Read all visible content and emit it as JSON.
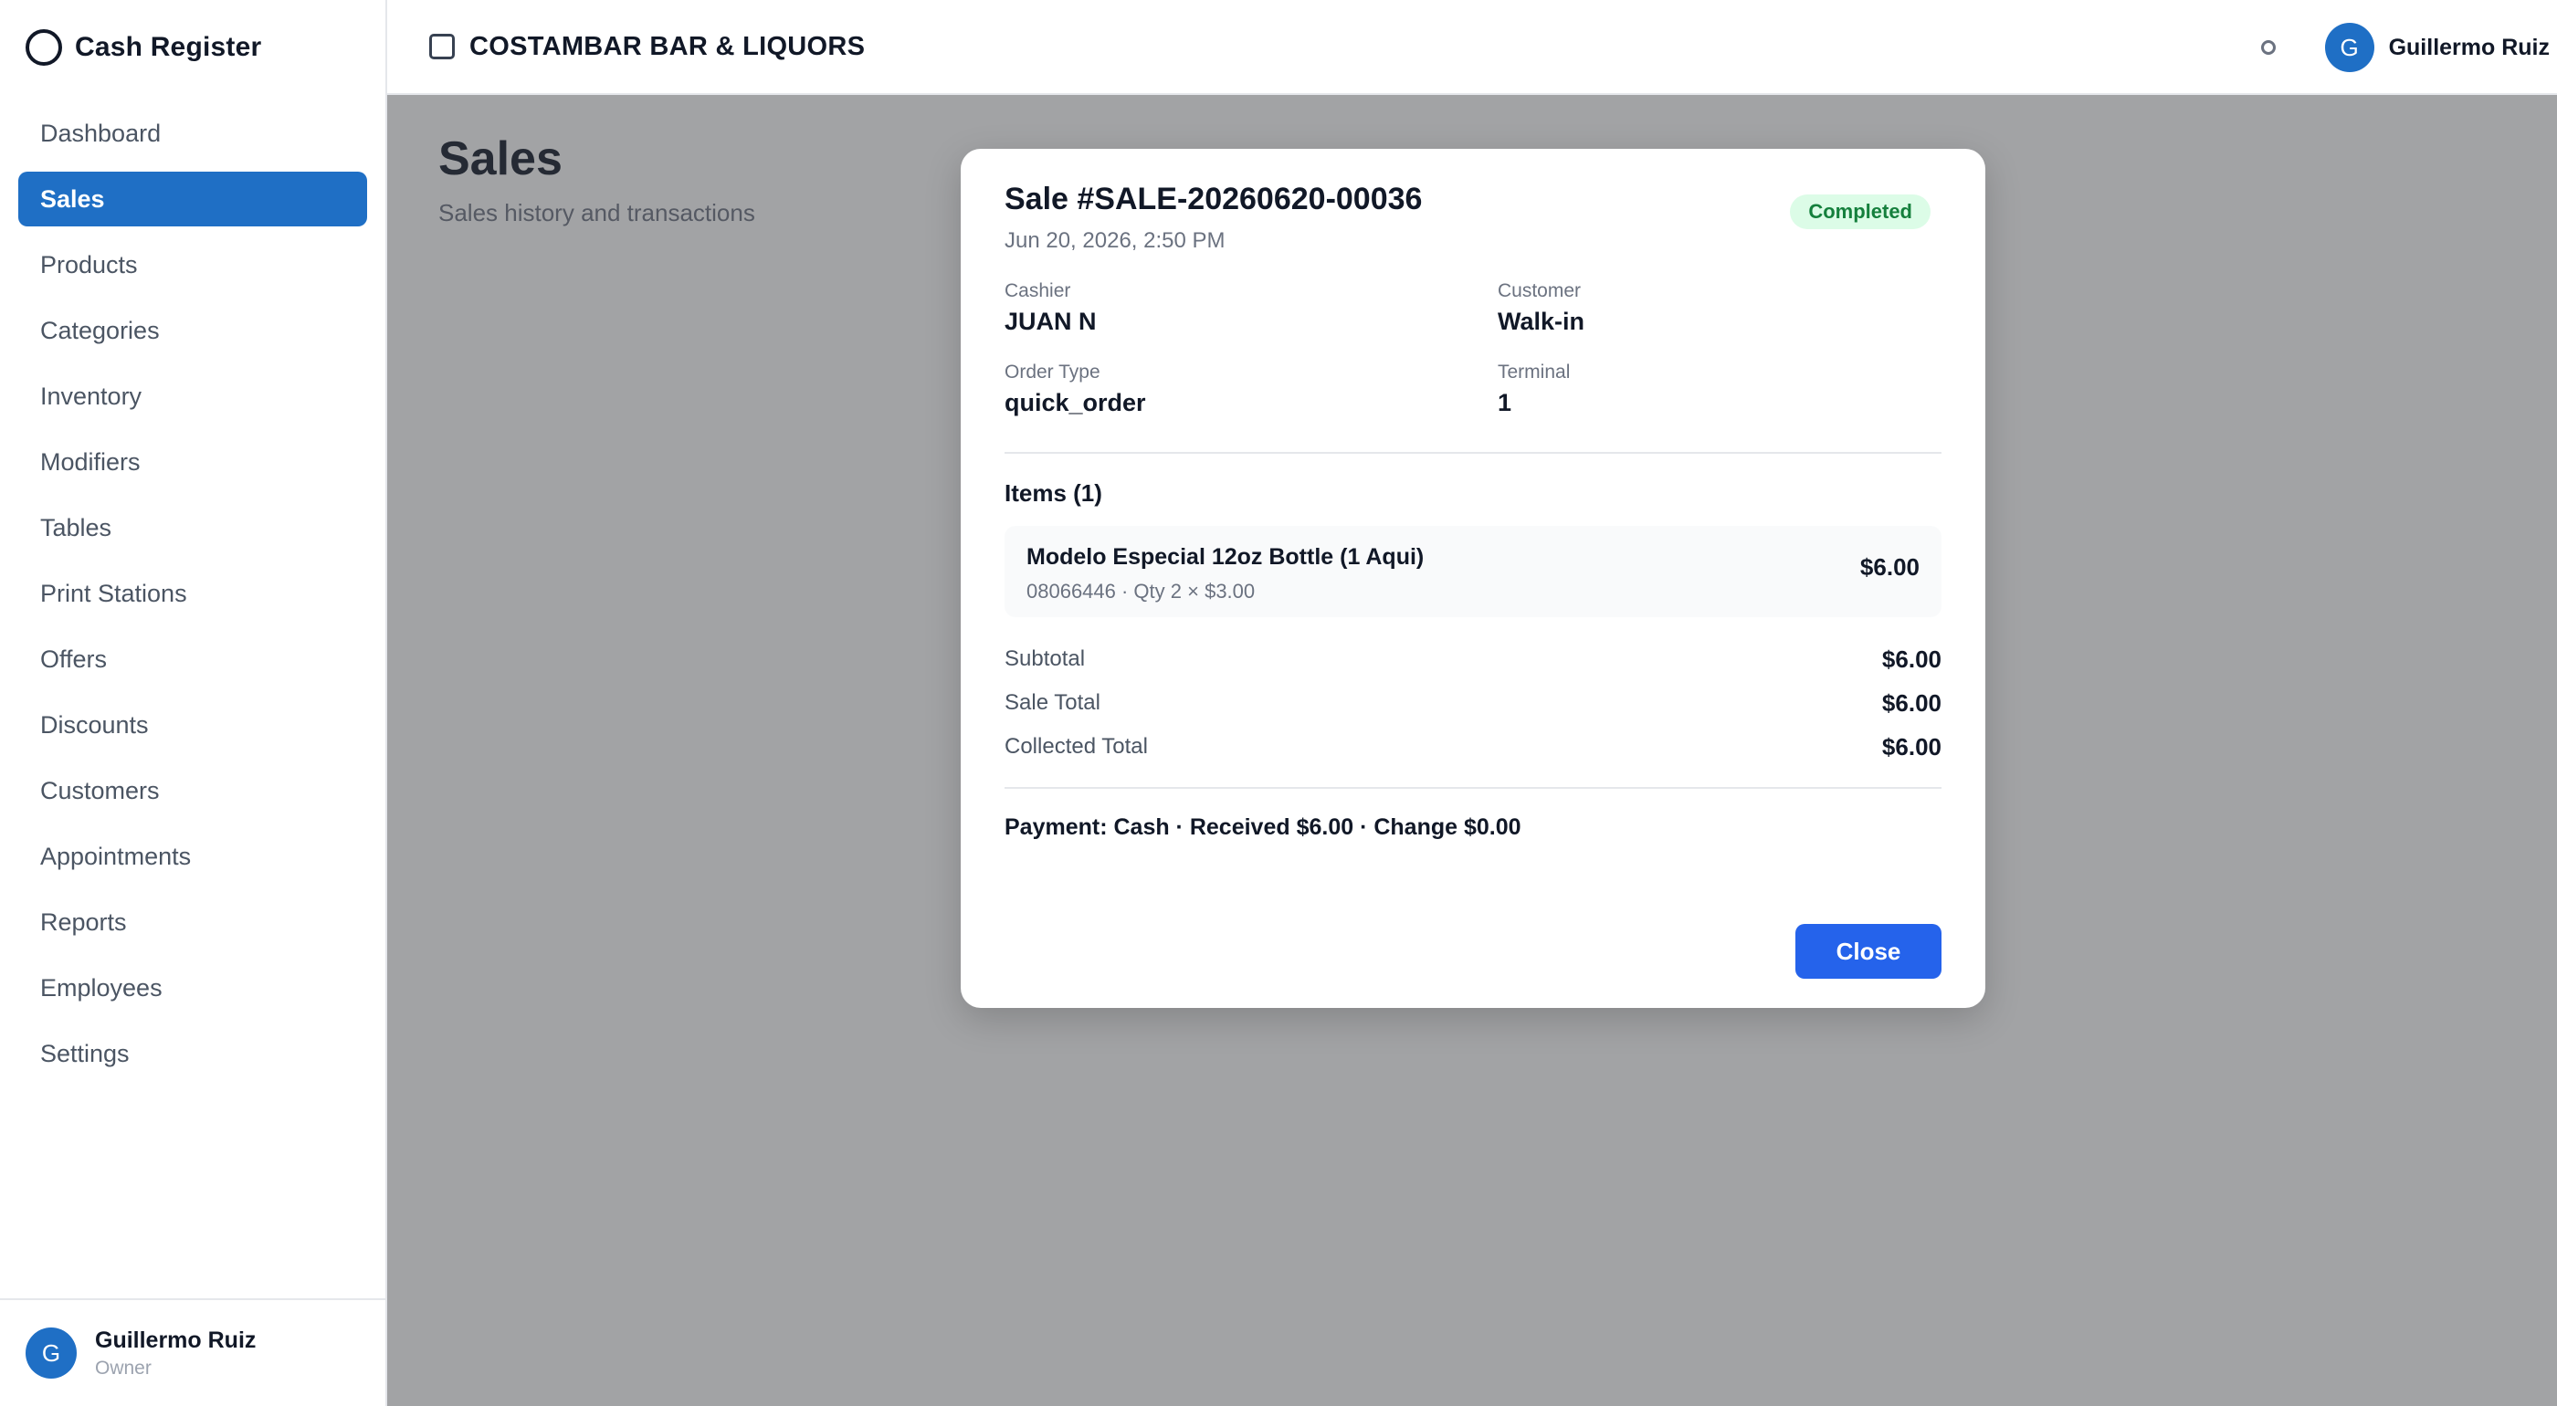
{
  "app": {
    "brand_title": "Cash Register",
    "store_name": "COSTAMBAR BAR & LIQUORS"
  },
  "sidebar": {
    "items": [
      {
        "label": "Dashboard",
        "active": false
      },
      {
        "label": "Sales",
        "active": true
      },
      {
        "label": "Products",
        "active": false
      },
      {
        "label": "Categories",
        "active": false
      },
      {
        "label": "Inventory",
        "active": false
      },
      {
        "label": "Modifiers",
        "active": false
      },
      {
        "label": "Tables",
        "active": false
      },
      {
        "label": "Print Stations",
        "active": false
      },
      {
        "label": "Offers",
        "active": false
      },
      {
        "label": "Discounts",
        "active": false
      },
      {
        "label": "Customers",
        "active": false
      },
      {
        "label": "Appointments",
        "active": false
      },
      {
        "label": "Reports",
        "active": false
      },
      {
        "label": "Employees",
        "active": false
      },
      {
        "label": "Settings",
        "active": false
      }
    ],
    "user": {
      "initial": "G",
      "name": "Guillermo Ruiz",
      "role": "Owner"
    }
  },
  "topbar": {
    "user_initial": "G",
    "user_name": "Guillermo Ruiz"
  },
  "page": {
    "title": "Sales",
    "subtitle": "Sales history and transactions"
  },
  "modal": {
    "title": "Sale #SALE-20260620-00036",
    "date": "Jun 20, 2026, 2:50 PM",
    "status": "Completed",
    "fields": {
      "cashier_label": "Cashier",
      "cashier_value": "JUAN N",
      "customer_label": "Customer",
      "customer_value": "Walk-in",
      "order_type_label": "Order Type",
      "order_type_value": "quick_order",
      "terminal_label": "Terminal",
      "terminal_value": "1"
    },
    "items_heading": "Items (1)",
    "items": [
      {
        "name": "Modelo Especial 12oz Bottle (1 Aqui)",
        "meta": "08066446 · Qty 2 × $3.00",
        "price": "$6.00"
      }
    ],
    "totals": [
      {
        "label": "Subtotal",
        "value": "$6.00"
      },
      {
        "label": "Sale Total",
        "value": "$6.00"
      },
      {
        "label": "Collected Total",
        "value": "$6.00"
      }
    ],
    "payment_line": "Payment: Cash · Received $6.00 · Change $0.00",
    "close_label": "Close"
  },
  "colors": {
    "accent": "#1f6fc5",
    "primary_button": "#2563eb",
    "status_bg": "#dcfce7",
    "status_text": "#15803d"
  },
  "icons": {
    "brand": "circle-icon",
    "store": "checkbox-icon",
    "status": "status-dot-icon"
  }
}
